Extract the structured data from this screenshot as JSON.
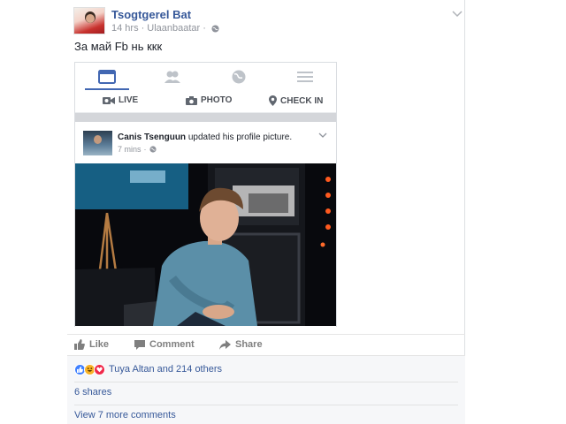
{
  "post": {
    "author": "Tsogtgerel Bat",
    "time": "14 hrs",
    "location": "Ulaanbaatar",
    "separator": "·",
    "text": "За май Fb нь ккк"
  },
  "shared_screenshot": {
    "nav_icons": [
      "news-feed-icon",
      "friends-icon",
      "globe-icon",
      "menu-icon"
    ],
    "composer": {
      "live": "LIVE",
      "photo": "PHOTO",
      "checkin": "CHECK IN"
    },
    "inner_post": {
      "author": "Canis Tsenguun",
      "action": "updated his profile picture.",
      "time": "7 mins",
      "separator": "·"
    }
  },
  "actions": {
    "like": "Like",
    "comment": "Comment",
    "share": "Share"
  },
  "footer": {
    "reactions_text": "Tuya Altan and 214 others",
    "reaction_icons": [
      "like-reaction-icon",
      "haha-reaction-icon",
      "love-reaction-icon"
    ],
    "shares": "6 shares",
    "more_comments": "View 7 more comments"
  },
  "colors": {
    "link": "#365899",
    "accent": "#4267b2",
    "muted": "#90949c",
    "love": "#f0284a",
    "haha": "#f7b125"
  }
}
